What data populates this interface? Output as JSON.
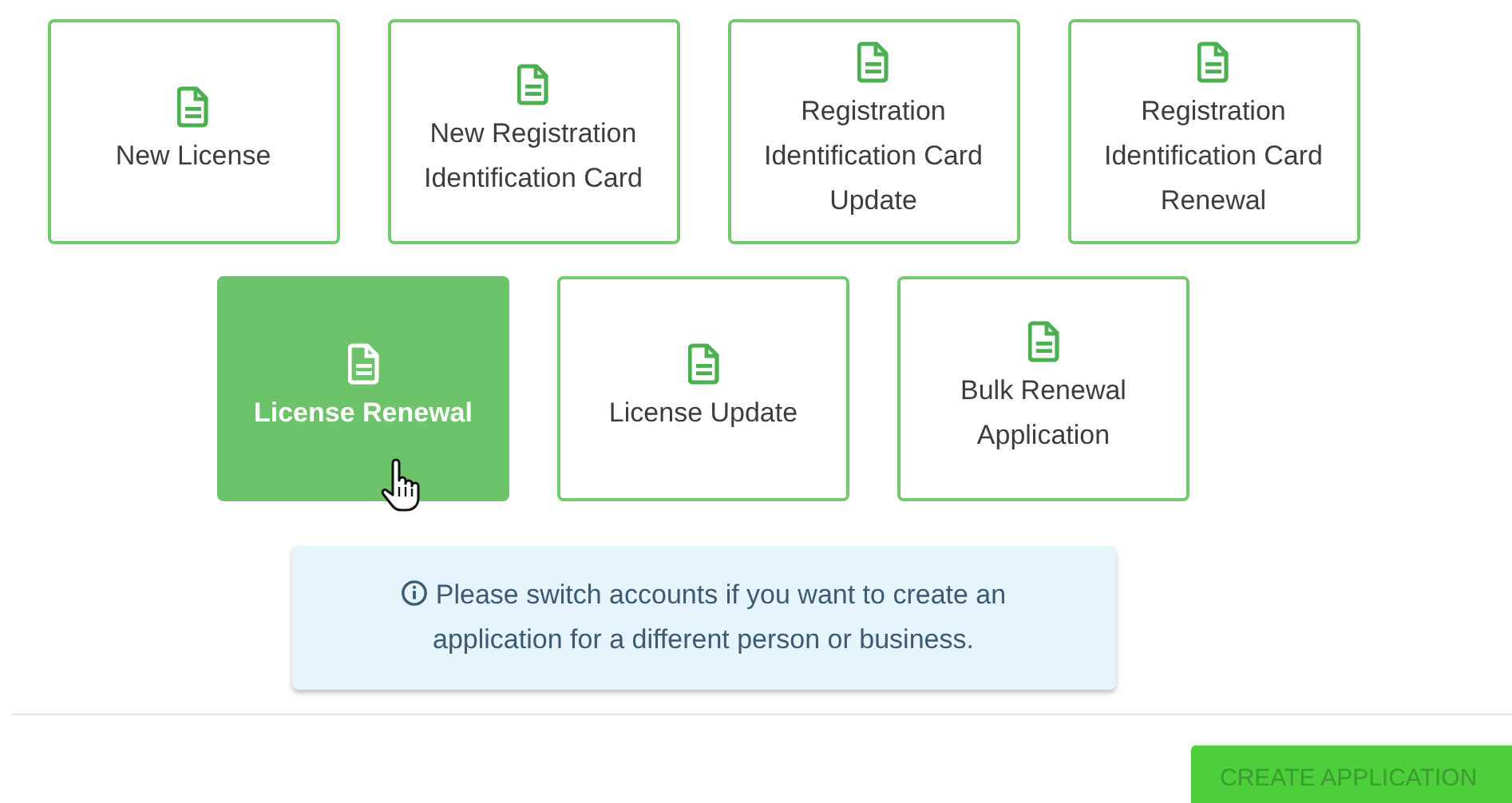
{
  "application_types": [
    {
      "label": "New License",
      "selected": false
    },
    {
      "label": "New Registration Identification Card",
      "selected": false
    },
    {
      "label": "Registration Identification Card Update",
      "selected": false
    },
    {
      "label": "Registration Identification Card Renewal",
      "selected": false
    },
    {
      "label": "License Renewal",
      "selected": true
    },
    {
      "label": "License Update",
      "selected": false
    },
    {
      "label": "Bulk Renewal Application",
      "selected": false
    }
  ],
  "info_notice": "Please switch accounts if you want to create an application for a different person or business.",
  "create_button": {
    "label": "CREATE APPLICATION",
    "disabled": true
  }
}
